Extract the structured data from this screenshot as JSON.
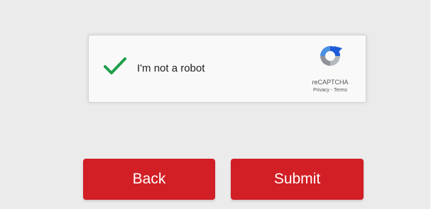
{
  "recaptcha": {
    "label": "I'm not a robot",
    "checked": true,
    "check_color": "#1e9e4a",
    "brand": "reCAPTCHA",
    "privacy_link": "Privacy",
    "separator": " - ",
    "terms_link": "Terms",
    "logo_icon": "recaptcha-logo-icon"
  },
  "actions": {
    "back_label": "Back",
    "submit_label": "Submit",
    "button_color": "#d11f25"
  }
}
